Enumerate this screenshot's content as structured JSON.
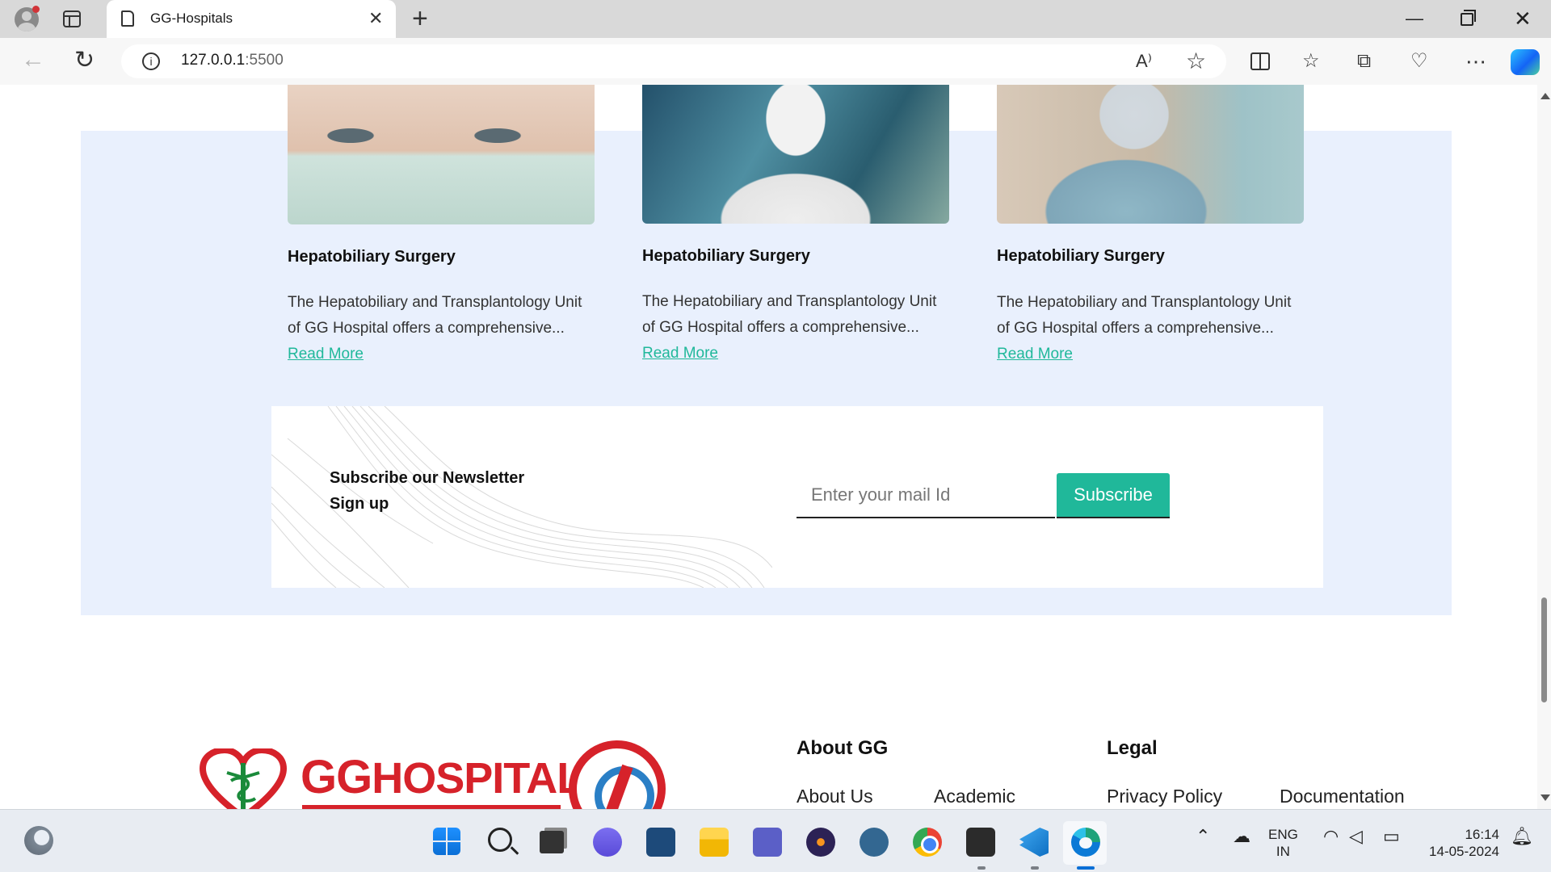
{
  "browser": {
    "tab_title": "GG-Hospitals",
    "address_host": "127.0.0.1",
    "address_port": ":5500",
    "read_aloud_glyph": "A⁾"
  },
  "services": {
    "cards": [
      {
        "image": "masked-nurse-photo",
        "title": "Hepatobiliary Surgery",
        "desc": "The Hepatobiliary and Transplantology Unit of GG Hospital offers a comprehensive...",
        "link": "Read More"
      },
      {
        "image": "masked-patient-photo",
        "title": "Hepatobiliary Surgery",
        "desc": "The Hepatobiliary and Transplantology Unit of GG Hospital offers a comprehensive...",
        "link": "Read More"
      },
      {
        "image": "surgeon-newborn-photo",
        "title": "Hepatobiliary Surgery",
        "desc": "The Hepatobiliary and Transplantology Unit of GG Hospital offers a comprehensive...",
        "link": "Read More"
      }
    ]
  },
  "newsletter": {
    "title_line1": "Subscribe our Newsletter",
    "title_line2": "Sign up",
    "placeholder": "Enter your mail Id",
    "button": "Subscribe"
  },
  "footer": {
    "logo_text_gg": "GG",
    "logo_text_rest": "HOSPITAL",
    "about_heading": "About GG",
    "about_links": [
      "About Us",
      "Academic"
    ],
    "legal_heading": "Legal",
    "legal_links": [
      "Privacy Policy",
      "Documentation"
    ]
  },
  "taskbar": {
    "lang_line1": "ENG",
    "lang_line2": "IN",
    "time": "16:14",
    "date": "14-05-2024"
  },
  "colors": {
    "accent": "#20b89a",
    "section_bg": "#e9f0fd",
    "brand_red": "#d6222a"
  }
}
